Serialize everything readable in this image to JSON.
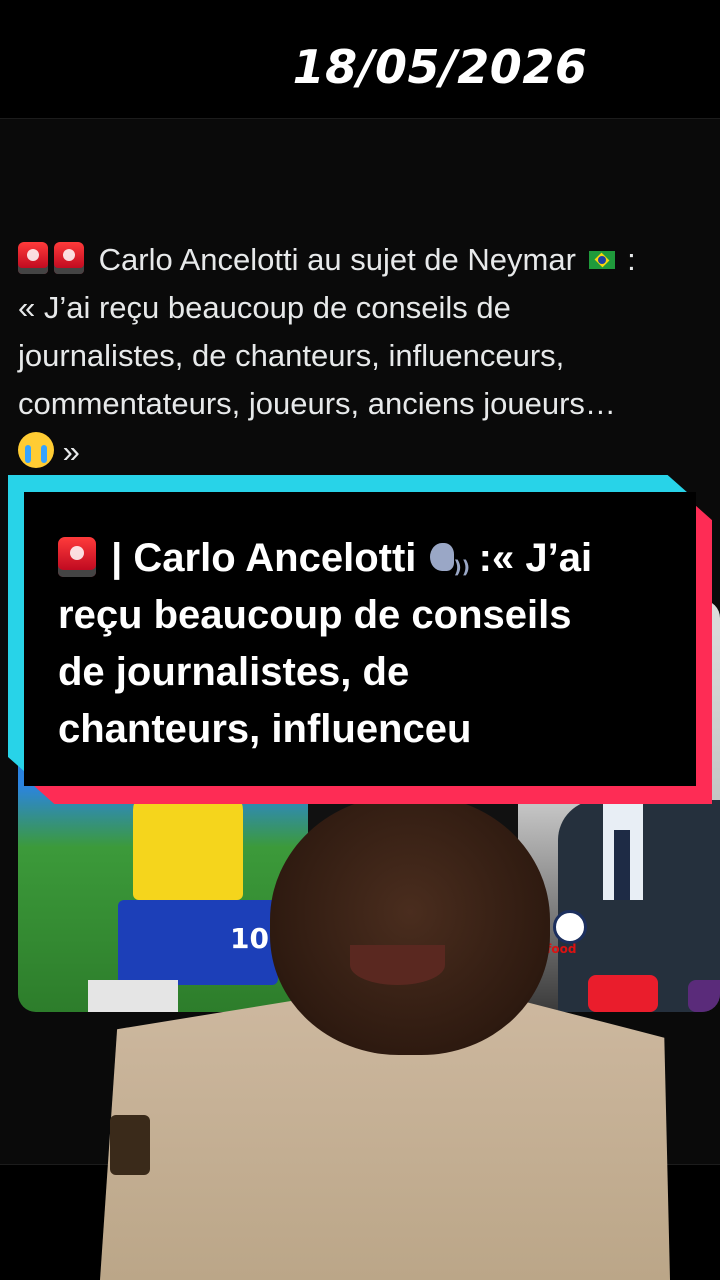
{
  "overlay": {
    "date": "18/05/2026"
  },
  "tweet": {
    "line1": "Carlo Ancelotti au sujet de Neymar",
    "line1_suffix": " :",
    "body": "« J’ai reçu beaucoup de conseils de\njournalistes, de chanteurs, influenceurs,\ncommentateurs, joueurs, anciens joueurs…",
    "end": " »"
  },
  "headline_card": {
    "part1": " | Carlo Ancelotti ",
    "part2": ":« J’ai\nreçu beaucoup de conseils\nde journalistes, de\nchanteurs, influenceu"
  },
  "media": {
    "jersey_number": "10",
    "sponsor": "ifood"
  },
  "icons": [
    "siren-icon",
    "brazil-flag-icon",
    "crying-face-icon",
    "speaking-head-icon"
  ],
  "colors": {
    "cyan": "#28d3e8",
    "pink": "#fe2c55",
    "background": "#000000"
  }
}
